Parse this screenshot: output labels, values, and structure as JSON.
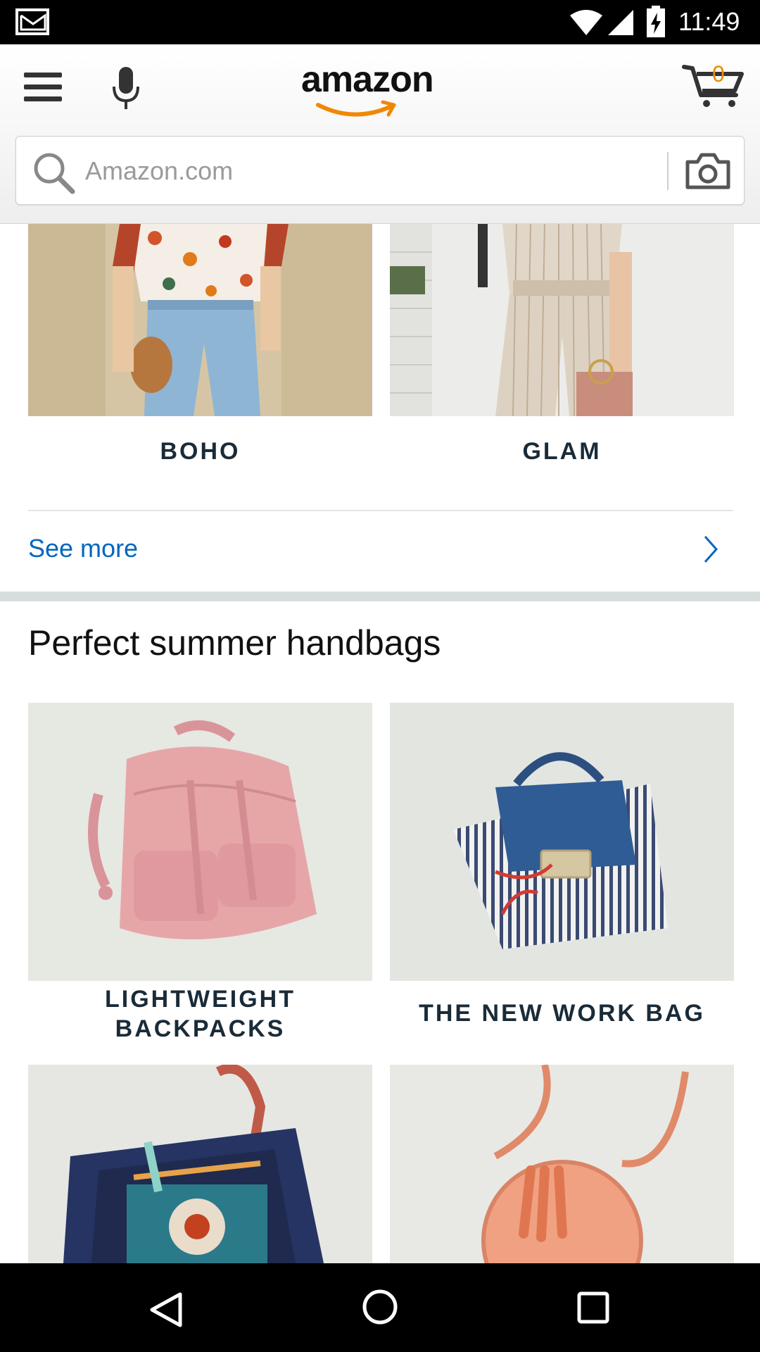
{
  "status_bar": {
    "time": "11:49",
    "icons": [
      "gmail-icon",
      "wifi-icon",
      "signal-icon",
      "battery-icon"
    ]
  },
  "header": {
    "logo_text": "amazon",
    "cart_count": "0",
    "search_placeholder": "Amazon.com",
    "brand_accent_color": "#f08804"
  },
  "styles_row": {
    "items": [
      {
        "label": "BOHO"
      },
      {
        "label": "GLAM"
      }
    ],
    "see_more_label": "See more"
  },
  "handbags_section": {
    "title": "Perfect summer handbags",
    "items": [
      {
        "label_line1": "LIGHTWEIGHT",
        "label_line2": "BACKPACKS"
      },
      {
        "label": "THE NEW WORK BAG"
      },
      {
        "label": ""
      },
      {
        "label": ""
      }
    ]
  },
  "colors": {
    "link": "#0066c0",
    "label_text": "#1a2b38",
    "section_separator": "#d7dcdd"
  },
  "nav_bar": {
    "buttons": [
      "back-icon",
      "home-icon",
      "recents-icon"
    ]
  }
}
